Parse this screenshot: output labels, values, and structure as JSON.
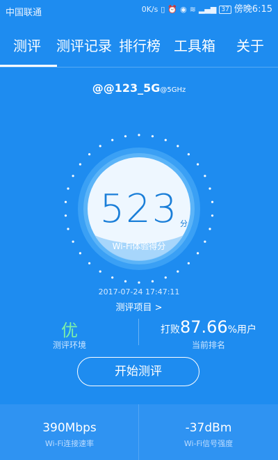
{
  "statusbar": {
    "carrier": "中国联通",
    "net_speed": "0K/s",
    "battery": "37",
    "time": "傍晚6:15"
  },
  "tabs": [
    {
      "label": "测评"
    },
    {
      "label": "测评记录"
    },
    {
      "label": "排行榜"
    },
    {
      "label": "工具箱"
    },
    {
      "label": "关于"
    }
  ],
  "wifi": {
    "ssid": "@@123_5G",
    "band": "@5GHz"
  },
  "score": {
    "value": "523",
    "unit": "分",
    "label": "Wi-Fi体验得分"
  },
  "test": {
    "time": "2017-07-24 17:47:11",
    "items_link": "测评项目 >"
  },
  "summary": {
    "quality": "优",
    "quality_label": "测评环境",
    "beat_prefix": "打败",
    "beat_value": "87.66",
    "beat_suffix_pct": "%",
    "beat_suffix": "用户",
    "rank_label": "当前排名"
  },
  "start_button": "开始测评",
  "bottom": {
    "speed": "390Mbps",
    "speed_label": "Wi-Fi连接速率",
    "signal": "-37dBm",
    "signal_label": "Wi-Fi信号强度"
  },
  "colors": {
    "background": "#1e8cf0",
    "quality_green": "#7cf0a8",
    "score_blue": "#1a7ed8"
  }
}
